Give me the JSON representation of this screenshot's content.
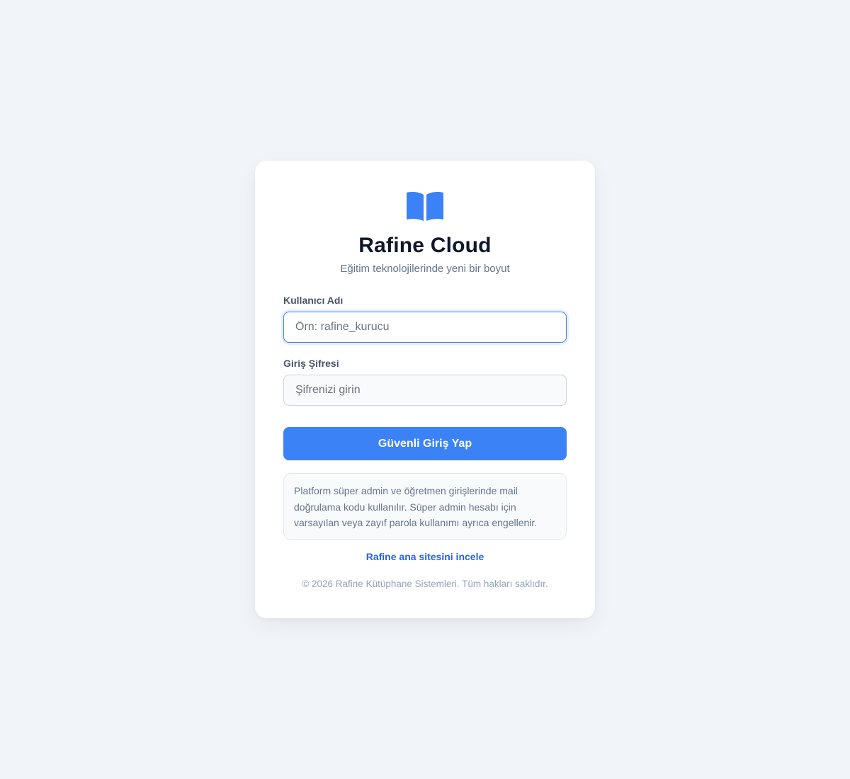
{
  "brand": {
    "title": "Rafine Cloud",
    "subtitle": "Eğitim teknolojilerinde yeni bir boyut",
    "icon": "book-open-icon",
    "accent_color": "#3b82f6"
  },
  "form": {
    "username_label": "Kullanıcı Adı",
    "username_placeholder": "Örn: rafine_kurucu",
    "username_value": "",
    "password_label": "Giriş Şifresi",
    "password_placeholder": "Şifrenizi girin",
    "password_value": "",
    "submit_label": "Güvenli Giriş Yap"
  },
  "info": {
    "text": "Platform süper admin ve öğretmen girişlerinde mail doğrulama kodu kullanılır. Süper admin hesabı için varsayılan veya zayıf parola kullanımı ayrıca engellenir."
  },
  "links": {
    "site_label": "Rafine ana sitesini incele"
  },
  "footer": {
    "copyright": "© 2026 Rafine Kütüphane Sistemleri. Tüm hakları saklıdır."
  }
}
